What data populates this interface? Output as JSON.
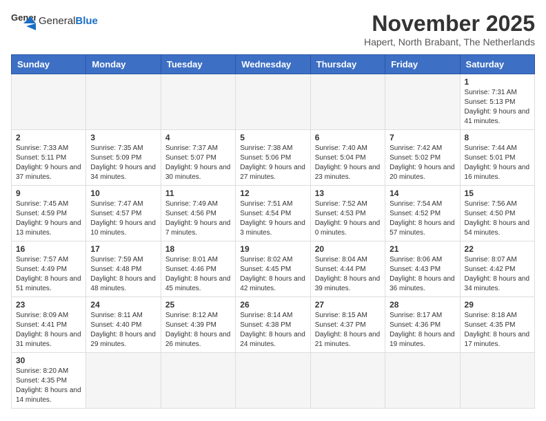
{
  "header": {
    "logo_general": "General",
    "logo_blue": "Blue",
    "month_title": "November 2025",
    "subtitle": "Hapert, North Brabant, The Netherlands"
  },
  "days_of_week": [
    "Sunday",
    "Monday",
    "Tuesday",
    "Wednesday",
    "Thursday",
    "Friday",
    "Saturday"
  ],
  "weeks": [
    [
      {
        "day": "",
        "info": ""
      },
      {
        "day": "",
        "info": ""
      },
      {
        "day": "",
        "info": ""
      },
      {
        "day": "",
        "info": ""
      },
      {
        "day": "",
        "info": ""
      },
      {
        "day": "",
        "info": ""
      },
      {
        "day": "1",
        "info": "Sunrise: 7:31 AM\nSunset: 5:13 PM\nDaylight: 9 hours and 41 minutes."
      }
    ],
    [
      {
        "day": "2",
        "info": "Sunrise: 7:33 AM\nSunset: 5:11 PM\nDaylight: 9 hours and 37 minutes."
      },
      {
        "day": "3",
        "info": "Sunrise: 7:35 AM\nSunset: 5:09 PM\nDaylight: 9 hours and 34 minutes."
      },
      {
        "day": "4",
        "info": "Sunrise: 7:37 AM\nSunset: 5:07 PM\nDaylight: 9 hours and 30 minutes."
      },
      {
        "day": "5",
        "info": "Sunrise: 7:38 AM\nSunset: 5:06 PM\nDaylight: 9 hours and 27 minutes."
      },
      {
        "day": "6",
        "info": "Sunrise: 7:40 AM\nSunset: 5:04 PM\nDaylight: 9 hours and 23 minutes."
      },
      {
        "day": "7",
        "info": "Sunrise: 7:42 AM\nSunset: 5:02 PM\nDaylight: 9 hours and 20 minutes."
      },
      {
        "day": "8",
        "info": "Sunrise: 7:44 AM\nSunset: 5:01 PM\nDaylight: 9 hours and 16 minutes."
      }
    ],
    [
      {
        "day": "9",
        "info": "Sunrise: 7:45 AM\nSunset: 4:59 PM\nDaylight: 9 hours and 13 minutes."
      },
      {
        "day": "10",
        "info": "Sunrise: 7:47 AM\nSunset: 4:57 PM\nDaylight: 9 hours and 10 minutes."
      },
      {
        "day": "11",
        "info": "Sunrise: 7:49 AM\nSunset: 4:56 PM\nDaylight: 9 hours and 7 minutes."
      },
      {
        "day": "12",
        "info": "Sunrise: 7:51 AM\nSunset: 4:54 PM\nDaylight: 9 hours and 3 minutes."
      },
      {
        "day": "13",
        "info": "Sunrise: 7:52 AM\nSunset: 4:53 PM\nDaylight: 9 hours and 0 minutes."
      },
      {
        "day": "14",
        "info": "Sunrise: 7:54 AM\nSunset: 4:52 PM\nDaylight: 8 hours and 57 minutes."
      },
      {
        "day": "15",
        "info": "Sunrise: 7:56 AM\nSunset: 4:50 PM\nDaylight: 8 hours and 54 minutes."
      }
    ],
    [
      {
        "day": "16",
        "info": "Sunrise: 7:57 AM\nSunset: 4:49 PM\nDaylight: 8 hours and 51 minutes."
      },
      {
        "day": "17",
        "info": "Sunrise: 7:59 AM\nSunset: 4:48 PM\nDaylight: 8 hours and 48 minutes."
      },
      {
        "day": "18",
        "info": "Sunrise: 8:01 AM\nSunset: 4:46 PM\nDaylight: 8 hours and 45 minutes."
      },
      {
        "day": "19",
        "info": "Sunrise: 8:02 AM\nSunset: 4:45 PM\nDaylight: 8 hours and 42 minutes."
      },
      {
        "day": "20",
        "info": "Sunrise: 8:04 AM\nSunset: 4:44 PM\nDaylight: 8 hours and 39 minutes."
      },
      {
        "day": "21",
        "info": "Sunrise: 8:06 AM\nSunset: 4:43 PM\nDaylight: 8 hours and 36 minutes."
      },
      {
        "day": "22",
        "info": "Sunrise: 8:07 AM\nSunset: 4:42 PM\nDaylight: 8 hours and 34 minutes."
      }
    ],
    [
      {
        "day": "23",
        "info": "Sunrise: 8:09 AM\nSunset: 4:41 PM\nDaylight: 8 hours and 31 minutes."
      },
      {
        "day": "24",
        "info": "Sunrise: 8:11 AM\nSunset: 4:40 PM\nDaylight: 8 hours and 29 minutes."
      },
      {
        "day": "25",
        "info": "Sunrise: 8:12 AM\nSunset: 4:39 PM\nDaylight: 8 hours and 26 minutes."
      },
      {
        "day": "26",
        "info": "Sunrise: 8:14 AM\nSunset: 4:38 PM\nDaylight: 8 hours and 24 minutes."
      },
      {
        "day": "27",
        "info": "Sunrise: 8:15 AM\nSunset: 4:37 PM\nDaylight: 8 hours and 21 minutes."
      },
      {
        "day": "28",
        "info": "Sunrise: 8:17 AM\nSunset: 4:36 PM\nDaylight: 8 hours and 19 minutes."
      },
      {
        "day": "29",
        "info": "Sunrise: 8:18 AM\nSunset: 4:35 PM\nDaylight: 8 hours and 17 minutes."
      }
    ],
    [
      {
        "day": "30",
        "info": "Sunrise: 8:20 AM\nSunset: 4:35 PM\nDaylight: 8 hours and 14 minutes."
      },
      {
        "day": "",
        "info": ""
      },
      {
        "day": "",
        "info": ""
      },
      {
        "day": "",
        "info": ""
      },
      {
        "day": "",
        "info": ""
      },
      {
        "day": "",
        "info": ""
      },
      {
        "day": "",
        "info": ""
      }
    ]
  ]
}
